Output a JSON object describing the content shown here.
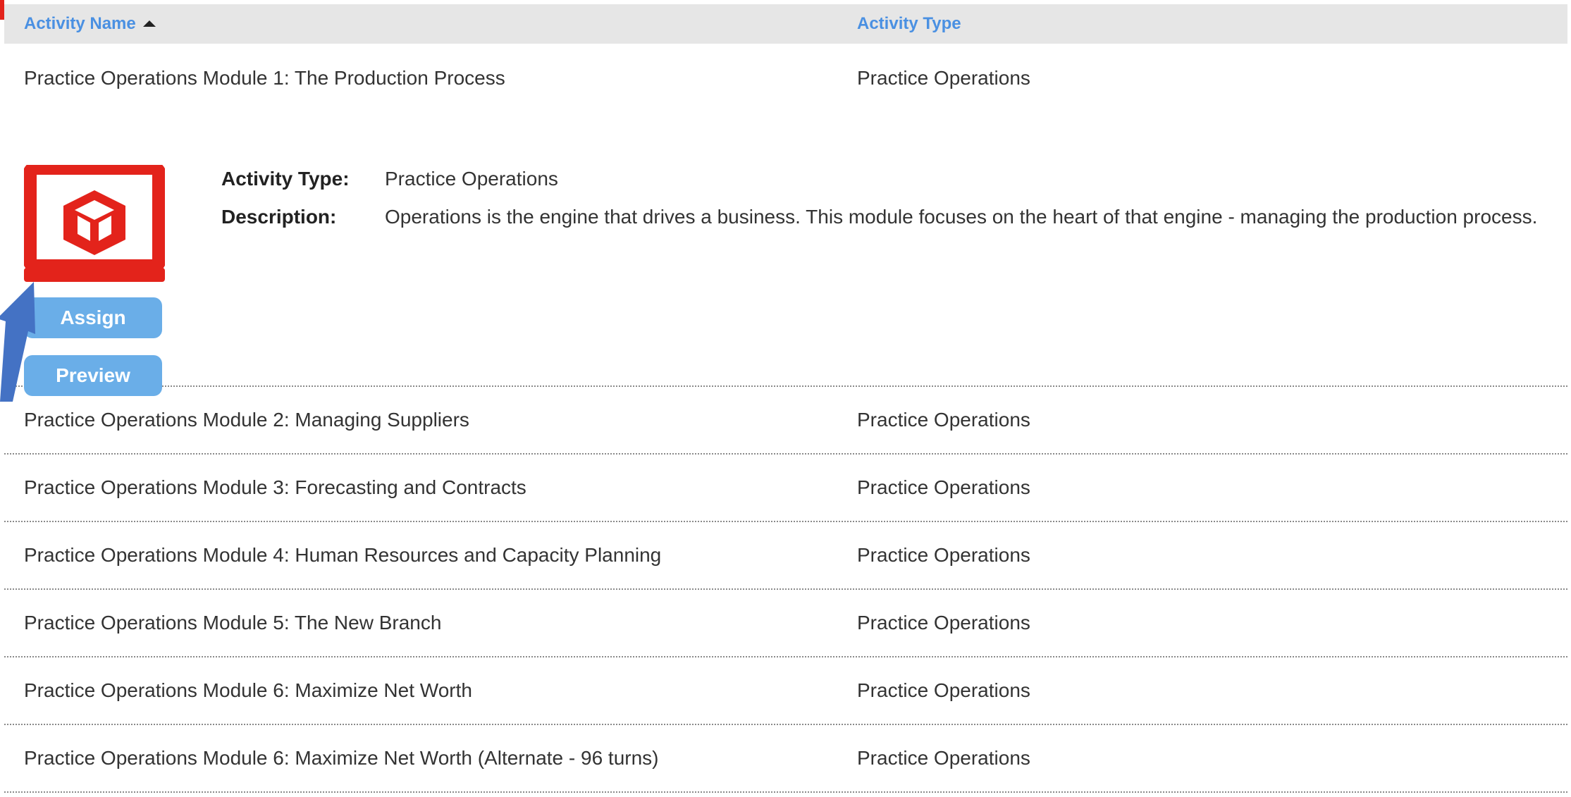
{
  "header": {
    "col_name": "Activity Name",
    "col_type": "Activity Type"
  },
  "expanded": {
    "name": "Practice Operations Module 1: The Production Process",
    "type": "Practice Operations",
    "type_label": "Activity Type:",
    "type_value": "Practice Operations",
    "desc_label": "Description:",
    "desc_value": "Operations is the engine that drives a business. This module focuses on the heart of that engine - managing the production process.",
    "assign_label": "Assign",
    "preview_label": "Preview",
    "icon": "laptop-cube-icon"
  },
  "rows": [
    {
      "name": "Practice Operations Module 2: Managing Suppliers",
      "type": "Practice Operations"
    },
    {
      "name": "Practice Operations Module 3: Forecasting and Contracts",
      "type": "Practice Operations"
    },
    {
      "name": "Practice Operations Module 4: Human Resources and Capacity Planning",
      "type": "Practice Operations"
    },
    {
      "name": "Practice Operations Module 5: The New Branch",
      "type": "Practice Operations"
    },
    {
      "name": "Practice Operations Module 6: Maximize Net Worth",
      "type": "Practice Operations"
    },
    {
      "name": "Practice Operations Module 6: Maximize Net Worth (Alternate - 96 turns)",
      "type": "Practice Operations"
    }
  ],
  "colors": {
    "accent": "#4a90e2",
    "button": "#6aaee8",
    "icon_red": "#e3231b",
    "arrow": "#4472c4"
  }
}
